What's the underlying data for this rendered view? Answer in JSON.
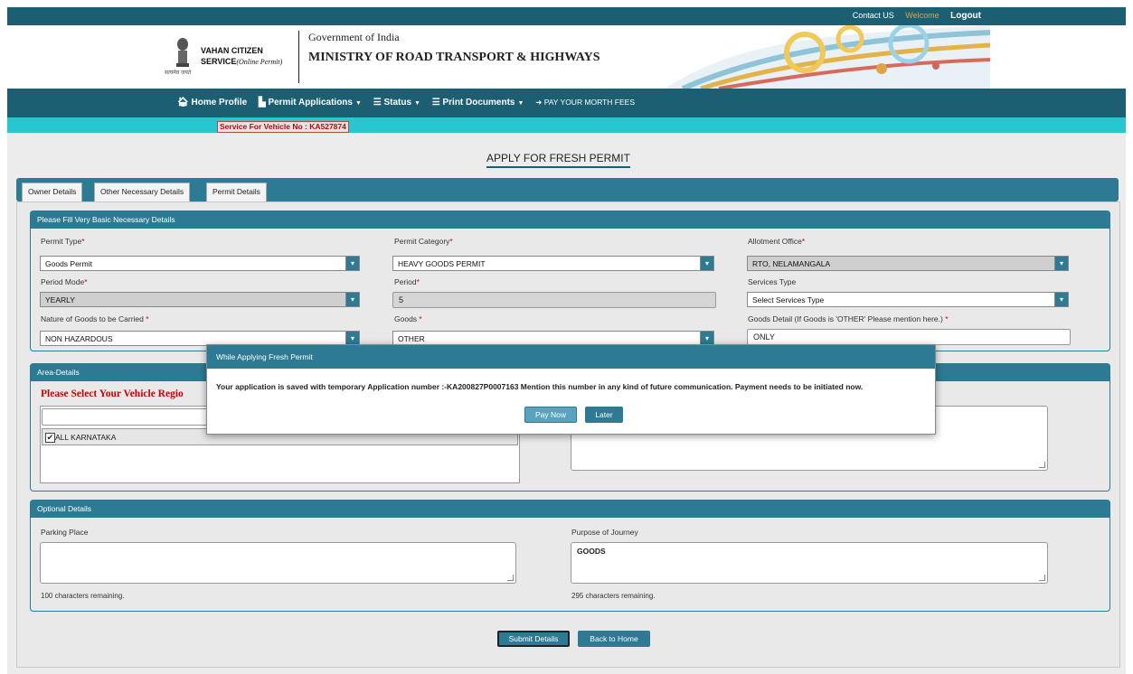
{
  "header": {
    "contact": "Contact US",
    "welcome": "Welcome",
    "logout": "Logout",
    "brand_line1": "VAHAN CITIZEN",
    "brand_line2": "SERVICE",
    "brand_sub": "(Online Permit)",
    "emblem_text": "सत्यमेव जयते",
    "gov": "Government of India",
    "ministry": "MINISTRY OF ROAD TRANSPORT & HIGHWAYS"
  },
  "nav": {
    "home": "Home Profile",
    "permit": "Permit Applications",
    "status": "Status",
    "print": "Print Documents",
    "pay": "PAY YOUR MORTH FEES"
  },
  "vehicle_service": "Service For Vehicle No : KA527874",
  "page_title": "APPLY FOR FRESH PERMIT",
  "tabs": [
    "Owner Details",
    "Other Necessary Details",
    "Permit Details"
  ],
  "basic": {
    "title": "Please Fill Very Basic Necessary Details",
    "permit_type_label": "Permit Type",
    "permit_type": "Goods Permit",
    "permit_category_label": "Permit Category",
    "permit_category": "HEAVY GOODS PERMIT",
    "allotment_label": "Allotment Office",
    "allotment": "RTO, NELAMANGALA",
    "period_mode_label": "Period Mode",
    "period_mode": "YEARLY",
    "period_label": "Period",
    "period": "5",
    "services_label": "Services Type",
    "services": "Select Services Type",
    "nature_label": "Nature of Goods to be Carried",
    "nature": "NON HAZARDOUS",
    "goods_label": "Goods",
    "goods": "OTHER",
    "goods_detail_label": "Goods Detail (If Goods is 'OTHER' Please mention here.)",
    "goods_detail": "ONLY"
  },
  "area": {
    "title": "Area-Details",
    "region_title": "Please Select Your Vehicle Regio",
    "region_item": "ALL KARNATAKA",
    "check": "✔"
  },
  "optional": {
    "title": "Optional Details",
    "parking_label": "Parking Place",
    "parking_value": "",
    "parking_remaining": "100 characters remaining.",
    "purpose_label": "Purpose of Journey",
    "purpose_value": "GOODS",
    "purpose_remaining": "295 characters remaining."
  },
  "buttons": {
    "submit": "Submit Details",
    "back": "Back to Home"
  },
  "modal": {
    "title": "While Applying Fresh Permit",
    "message": "Your application is saved with temporary Application number :-KA200827P0007163 Mention this number in any kind of future communication. Payment needs to be initiated now.",
    "pay_now": "Pay Now",
    "later": "Later"
  },
  "colors": {
    "header": "#1c5f73",
    "accent": "#2c7a94",
    "strip": "#28c7cf",
    "required": "#cc0000"
  }
}
